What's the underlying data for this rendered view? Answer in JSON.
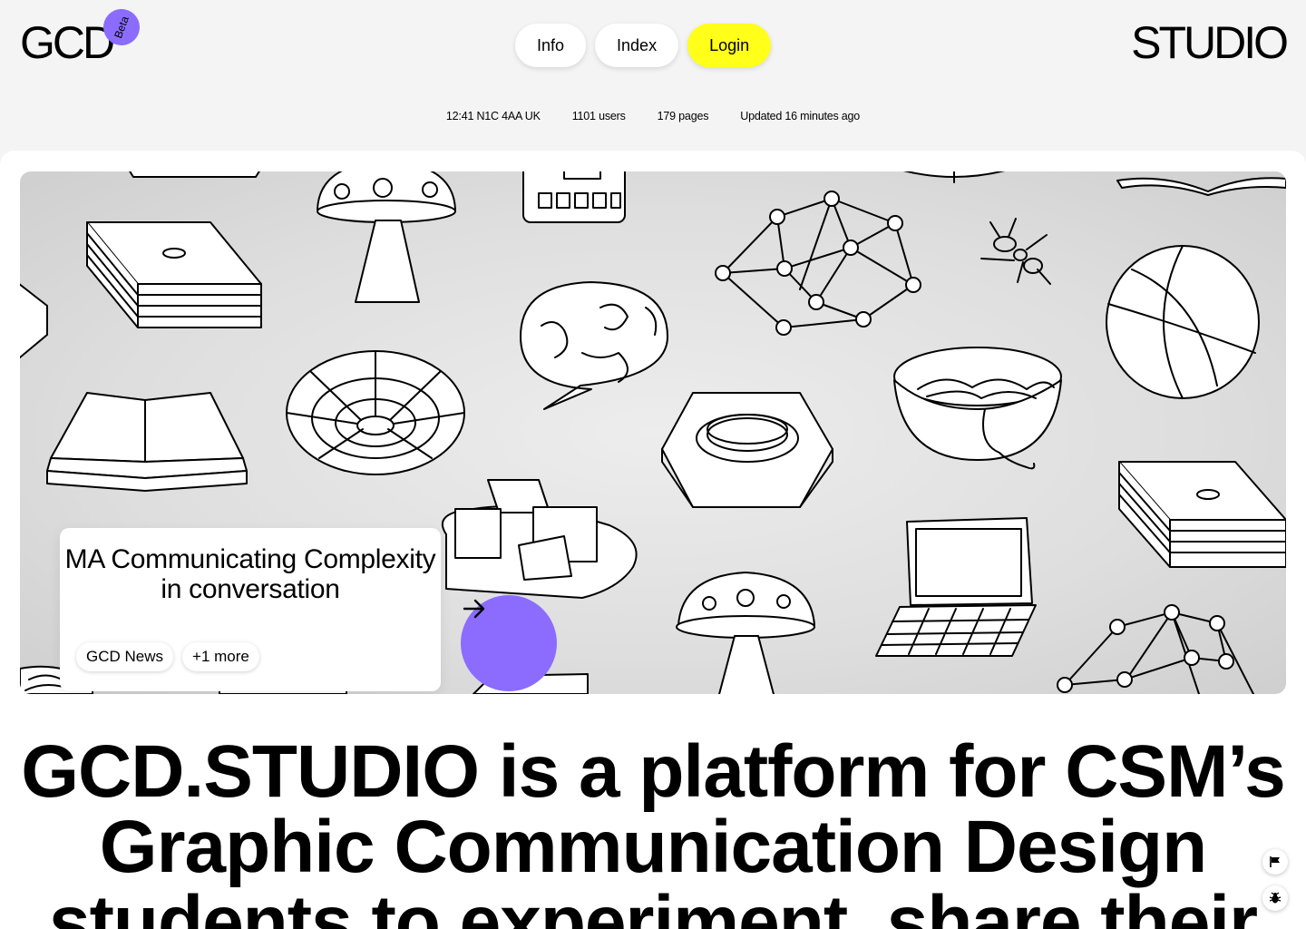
{
  "header": {
    "logo": "GCD",
    "beta_badge": "Beta",
    "nav": {
      "info": "Info",
      "index": "Index",
      "login": "Login"
    },
    "brand_right": "STUDIO",
    "stats": {
      "location": "12:41 N1C 4AA UK",
      "users": "1101 users",
      "pages": "179 pages",
      "updated": "Updated 16 minutes ago"
    }
  },
  "hero": {
    "card_title": "MA Communicating Complexity in conversation",
    "tags": [
      "GCD News",
      "+1 more"
    ],
    "arrow_icon": "arrow-right-icon"
  },
  "headline": "GCD.STUDIO is a platform for CSM’s\nGraphic Communication Design\nstudents to experiment, share their",
  "side_icons": [
    "flag-icon",
    "bug-icon"
  ],
  "colors": {
    "accent_purple": "#8b6cff",
    "login_yellow": "#ffff1a",
    "page_bg": "#f4f4f4"
  }
}
